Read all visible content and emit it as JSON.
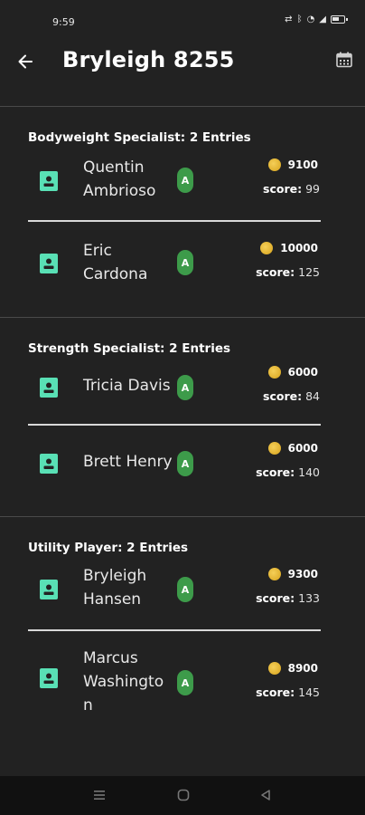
{
  "status": {
    "time": "9:59"
  },
  "header": {
    "title": "Bryleigh 8255"
  },
  "sections": [
    {
      "title": "Bodyweight Specialist: 2 Entries",
      "entries": [
        {
          "name_line1": "Quentin",
          "name_line2": "Ambrioso",
          "grade": "A",
          "coins": "9100",
          "score_label": "score:",
          "score": "99"
        },
        {
          "name_line1": "Eric",
          "name_line2": "Cardona",
          "grade": "A",
          "coins": "10000",
          "score_label": "score:",
          "score": "125"
        }
      ]
    },
    {
      "title": "Strength Specialist: 2 Entries",
      "entries": [
        {
          "name_line1": "Tricia Davis",
          "grade": "A",
          "coins": "6000",
          "score_label": "score:",
          "score": "84"
        },
        {
          "name_line1": "Brett Henry",
          "grade": "A",
          "coins": "6000",
          "score_label": "score:",
          "score": "140"
        }
      ]
    },
    {
      "title": "Utility Player: 2 Entries",
      "entries": [
        {
          "name_line1": "Bryleigh",
          "name_line2": "Hansen",
          "grade": "A",
          "coins": "9300",
          "score_label": "score:",
          "score": "133"
        },
        {
          "name_line1": "Marcus",
          "name_line2": "Washingto",
          "name_line3": "n",
          "grade": "A",
          "coins": "8900",
          "score_label": "score:",
          "score": "145"
        }
      ]
    }
  ],
  "colors": {
    "background": "#222222",
    "badge": "#3d9b4a",
    "avatar": "#59e0b5",
    "coin": "#e3b42e"
  }
}
